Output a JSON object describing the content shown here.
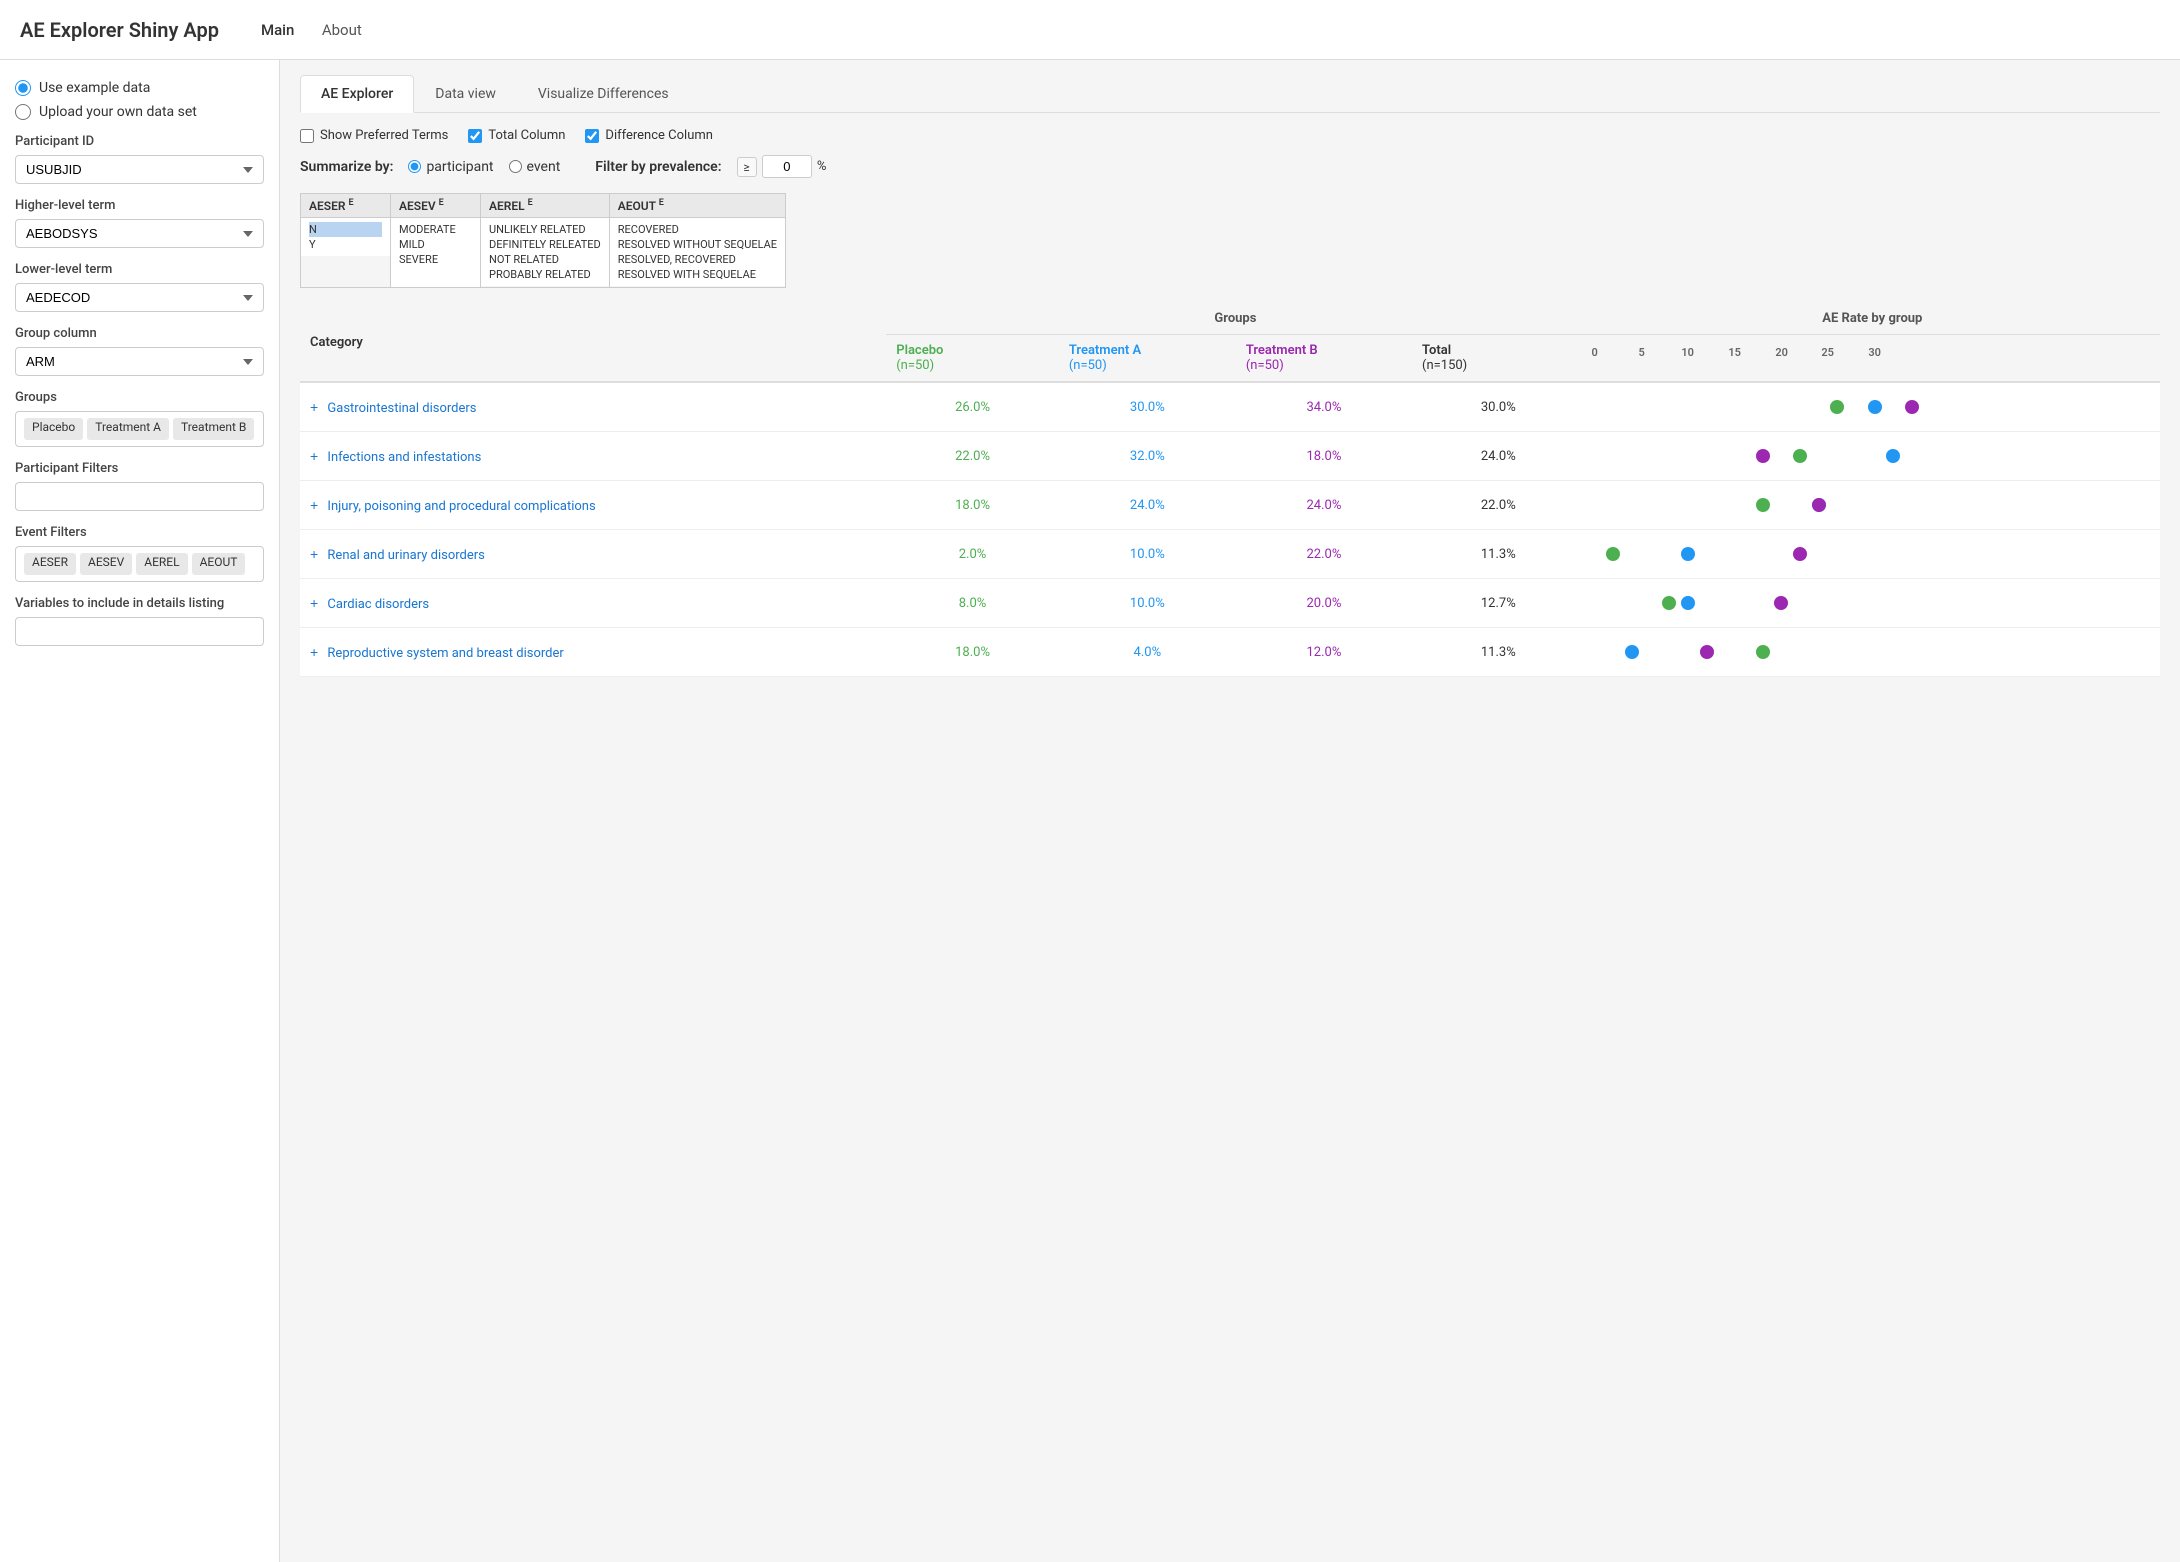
{
  "header": {
    "title": "AE Explorer Shiny App",
    "nav": [
      {
        "id": "main",
        "label": "Main",
        "active": true
      },
      {
        "id": "about",
        "label": "About",
        "active": false
      }
    ]
  },
  "sidebar": {
    "data_options": [
      {
        "id": "example",
        "label": "Use example data",
        "checked": true
      },
      {
        "id": "upload",
        "label": "Upload your own data set",
        "checked": false
      }
    ],
    "fields": [
      {
        "label": "Participant ID",
        "value": "USUBJID",
        "id": "participant-id"
      },
      {
        "label": "Higher-level term",
        "value": "AEBODSYS",
        "id": "higher-level-term"
      },
      {
        "label": "Lower-level term",
        "value": "AEDECOD",
        "id": "lower-level-term"
      },
      {
        "label": "Group column",
        "value": "ARM",
        "id": "group-column"
      }
    ],
    "groups_label": "Groups",
    "groups": [
      "Placebo",
      "Treatment A",
      "Treatment B"
    ],
    "participant_filters_label": "Participant Filters",
    "event_filters_label": "Event Filters",
    "event_filter_tags": [
      "AESER",
      "AESEV",
      "AEREL",
      "AEOUT"
    ],
    "variables_label": "Variables to include in details listing"
  },
  "tabs": [
    {
      "id": "ae-explorer",
      "label": "AE Explorer",
      "active": true
    },
    {
      "id": "data-view",
      "label": "Data view",
      "active": false
    },
    {
      "id": "visualize-diff",
      "label": "Visualize Differences",
      "active": false
    }
  ],
  "options": {
    "show_preferred_terms": {
      "label": "Show Preferred Terms",
      "checked": false
    },
    "total_column": {
      "label": "Total Column",
      "checked": true
    },
    "difference_column": {
      "label": "Difference Column",
      "checked": true
    }
  },
  "summarize": {
    "label": "Summarize by:",
    "options": [
      {
        "id": "participant",
        "label": "participant",
        "checked": true
      },
      {
        "id": "event",
        "label": "event",
        "checked": false
      }
    ],
    "filter_label": "Filter by prevalence:",
    "gte": "≥",
    "prevalence_value": "0",
    "percent": "%"
  },
  "filter_columns": [
    {
      "id": "AESER",
      "header": "AESER",
      "superscript": "E",
      "items": [
        "N",
        "Y"
      ]
    },
    {
      "id": "AESEV",
      "header": "AESEV",
      "superscript": "E",
      "items": [
        "MODERATE",
        "MILD",
        "SEVERE",
        ""
      ]
    },
    {
      "id": "AEREL",
      "header": "AEREL",
      "superscript": "E",
      "items": [
        "UNLIKELY RELATED",
        "DEFINITELY RELEATED",
        "NOT RELATED",
        "PROBABLY RELATED"
      ]
    },
    {
      "id": "AEOUT",
      "header": "AEOUT",
      "superscript": "E",
      "items": [
        "RECOVERED",
        "RESOLVED WITHOUT SEQUELAE",
        "RESOLVED, RECOVERED",
        "RESOLVED WITH SEQUELAE"
      ]
    }
  ],
  "table": {
    "groups_header": "Groups",
    "ae_rate_header": "AE Rate by group",
    "columns": {
      "category": "Category",
      "placebo": "Placebo",
      "placebo_n": "(n=50)",
      "treatA": "Treatment A",
      "treatA_n": "(n=50)",
      "treatB": "Treatment B",
      "treatB_n": "(n=50)",
      "total": "Total",
      "total_n": "(n=150)"
    },
    "chart_ticks": [
      0,
      5,
      10,
      15,
      20,
      25,
      30
    ],
    "rows": [
      {
        "id": "gastro",
        "category": "Gastrointestinal disorders",
        "expandable": true,
        "placebo": "26.0%",
        "treatA": "30.0%",
        "treatB": "34.0%",
        "total": "30.0%",
        "placebo_pct": 26,
        "treatA_pct": 30,
        "treatB_pct": 34
      },
      {
        "id": "infections",
        "category": "Infections and infestations",
        "expandable": true,
        "placebo": "22.0%",
        "treatA": "32.0%",
        "treatB": "18.0%",
        "total": "24.0%",
        "placebo_pct": 22,
        "treatA_pct": 32,
        "treatB_pct": 18
      },
      {
        "id": "injury",
        "category": "Injury, poisoning and procedural complications",
        "expandable": true,
        "placebo": "18.0%",
        "treatA": "24.0%",
        "treatB": "24.0%",
        "total": "22.0%",
        "placebo_pct": 18,
        "treatA_pct": 24,
        "treatB_pct": 24
      },
      {
        "id": "renal",
        "category": "Renal and urinary disorders",
        "expandable": true,
        "placebo": "2.0%",
        "treatA": "10.0%",
        "treatB": "22.0%",
        "total": "11.3%",
        "placebo_pct": 2,
        "treatA_pct": 10,
        "treatB_pct": 22
      },
      {
        "id": "cardiac",
        "category": "Cardiac disorders",
        "expandable": true,
        "placebo": "8.0%",
        "treatA": "10.0%",
        "treatB": "20.0%",
        "total": "12.7%",
        "placebo_pct": 8,
        "treatA_pct": 10,
        "treatB_pct": 20
      },
      {
        "id": "reproductive",
        "category": "Reproductive system and breast disorder",
        "expandable": true,
        "placebo": "18.0%",
        "treatA": "4.0%",
        "treatB": "12.0%",
        "total": "11.3%",
        "placebo_pct": 18,
        "treatA_pct": 4,
        "treatB_pct": 12
      }
    ]
  }
}
